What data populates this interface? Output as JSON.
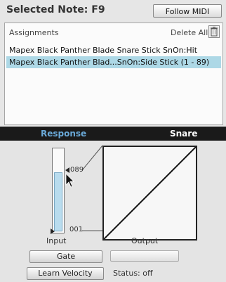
{
  "header": {
    "title": "Selected Note:  F9",
    "follow_midi_label": "Follow MIDI"
  },
  "assignments": {
    "label": "Assignments",
    "delete_all_label": "Delete All",
    "items": [
      {
        "text": "Mapex Black Panther Blade Snare Stick SnOn:Hit",
        "selected": false
      },
      {
        "text": "Mapex Black Panther Blad...SnOn:Side Stick (1 - 89)",
        "selected": true
      }
    ]
  },
  "response": {
    "header_left": "Response",
    "header_right": "Snare",
    "meter_top_value": "089",
    "meter_bottom_value": "001",
    "meter_level_fraction": 0.72,
    "input_label": "Input",
    "output_label": "Output",
    "gate_label": "Gate",
    "learn_velocity_label": "Learn Velocity",
    "status_text": "Status: off"
  },
  "colors": {
    "header_bg": "#1a1a1a",
    "response_accent": "#6aa9d8",
    "selection": "#add8e6"
  }
}
